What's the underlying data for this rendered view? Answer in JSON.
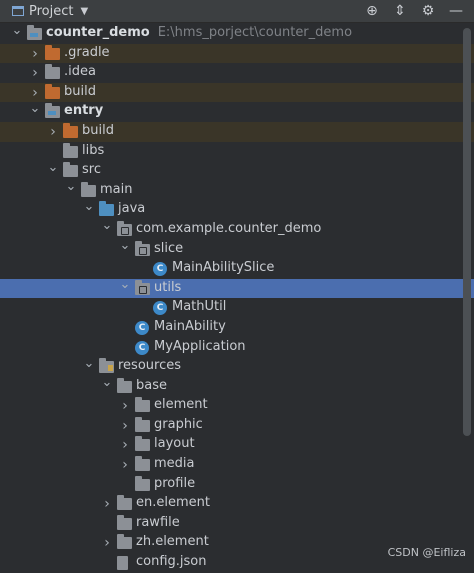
{
  "toolbar": {
    "title": "Project",
    "icons": [
      "project-window-icon",
      "chevron-down-icon",
      "target-icon",
      "collapse-icon",
      "gear-icon",
      "minimize-icon"
    ]
  },
  "tree": [
    {
      "label": "counter_demo",
      "path": "E:\\hms_porject\\counter_demo",
      "depth": 0,
      "expanded": true,
      "icon": "module-folder-icon",
      "bold": true
    },
    {
      "label": ".gradle",
      "depth": 1,
      "expanded": false,
      "icon": "excluded-folder-icon",
      "excluded": true
    },
    {
      "label": ".idea",
      "depth": 1,
      "expanded": false,
      "icon": "folder-icon"
    },
    {
      "label": "build",
      "depth": 1,
      "expanded": false,
      "icon": "excluded-folder-icon",
      "excluded": true
    },
    {
      "label": "entry",
      "depth": 1,
      "expanded": true,
      "icon": "module-folder-icon",
      "bold": true
    },
    {
      "label": "build",
      "depth": 2,
      "expanded": false,
      "icon": "excluded-folder-icon",
      "excluded": true
    },
    {
      "label": "libs",
      "depth": 2,
      "icon": "folder-icon"
    },
    {
      "label": "src",
      "depth": 2,
      "expanded": true,
      "icon": "folder-icon"
    },
    {
      "label": "main",
      "depth": 3,
      "expanded": true,
      "icon": "folder-icon"
    },
    {
      "label": "java",
      "depth": 4,
      "expanded": true,
      "icon": "source-folder-icon"
    },
    {
      "label": "com.example.counter_demo",
      "depth": 5,
      "expanded": true,
      "icon": "package-icon"
    },
    {
      "label": "slice",
      "depth": 6,
      "expanded": true,
      "icon": "package-icon"
    },
    {
      "label": "MainAbilitySlice",
      "depth": 7,
      "icon": "class-icon"
    },
    {
      "label": "utils",
      "depth": 6,
      "expanded": true,
      "icon": "package-icon",
      "selected": true
    },
    {
      "label": "MathUtil",
      "depth": 7,
      "icon": "class-icon"
    },
    {
      "label": "MainAbility",
      "depth": 6,
      "icon": "class-icon"
    },
    {
      "label": "MyApplication",
      "depth": 6,
      "icon": "class-icon"
    },
    {
      "label": "resources",
      "depth": 4,
      "expanded": true,
      "icon": "resources-folder-icon"
    },
    {
      "label": "base",
      "depth": 5,
      "expanded": true,
      "icon": "folder-icon"
    },
    {
      "label": "element",
      "depth": 6,
      "expanded": false,
      "icon": "folder-icon"
    },
    {
      "label": "graphic",
      "depth": 6,
      "expanded": false,
      "icon": "folder-icon"
    },
    {
      "label": "layout",
      "depth": 6,
      "expanded": false,
      "icon": "folder-icon"
    },
    {
      "label": "media",
      "depth": 6,
      "expanded": false,
      "icon": "folder-icon"
    },
    {
      "label": "profile",
      "depth": 6,
      "icon": "folder-icon"
    },
    {
      "label": "en.element",
      "depth": 5,
      "expanded": false,
      "icon": "folder-icon"
    },
    {
      "label": "rawfile",
      "depth": 5,
      "icon": "folder-icon"
    },
    {
      "label": "zh.element",
      "depth": 5,
      "expanded": false,
      "icon": "folder-icon"
    },
    {
      "label": "config.json",
      "depth": 5,
      "icon": "json-file-icon"
    }
  ],
  "watermark": "CSDN @Eifliza",
  "colors": {
    "background": "#2b2d30",
    "selection": "#4b6eaf",
    "excluded_row": "#3a3528",
    "excluded_folder": "#c06a30",
    "source_folder": "#4e8fc0",
    "class_icon": "#3d89c8"
  }
}
